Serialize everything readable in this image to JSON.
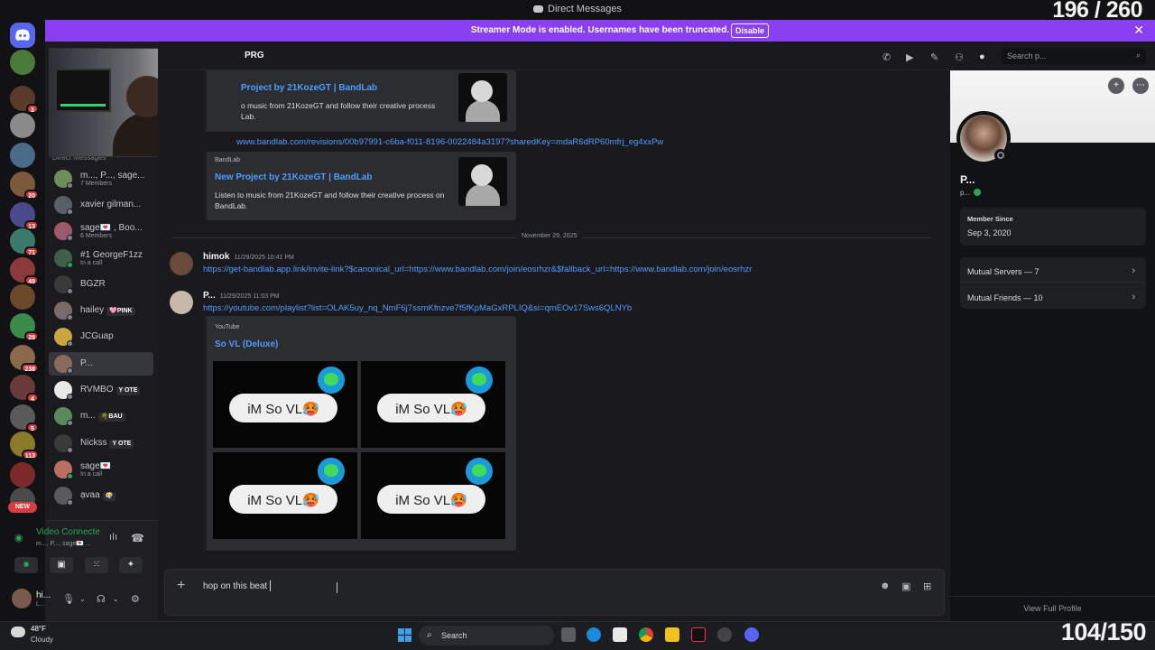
{
  "window": {
    "title": "Direct Messages",
    "overlay_counter_top": "196 / 260",
    "overlay_counter_bottom": "104/150"
  },
  "banner": {
    "message": "Streamer Mode is enabled. Usernames have been truncated.",
    "disable_label": "Disable"
  },
  "servers": [
    {
      "badge": ""
    },
    {
      "badge": "3"
    },
    {
      "badge": ""
    },
    {
      "badge": ""
    },
    {
      "badge": "20"
    },
    {
      "badge": "13"
    },
    {
      "badge": "71"
    },
    {
      "badge": "49"
    },
    {
      "badge": ""
    },
    {
      "badge": "28"
    },
    {
      "badge": "238"
    },
    {
      "badge": "4"
    },
    {
      "badge": "5"
    },
    {
      "badge": "113"
    },
    {
      "badge": ""
    },
    {
      "badge": ""
    }
  ],
  "servers_new_label": "NEW",
  "dm_section_label": "Direct Messages",
  "dms": [
    {
      "name": "m..., P..., sage...",
      "sub": "7 Members",
      "tag": "",
      "color": "#6b8e5a"
    },
    {
      "name": "xavier gilman...",
      "sub": "",
      "tag": "",
      "color": "#5a5f66"
    },
    {
      "name": "sage💌 , Boo...",
      "sub": "6 Members",
      "tag": "",
      "color": "#9a5a6a"
    },
    {
      "name": "#1 GeorgeF1zz",
      "sub": "In a call",
      "tag": "",
      "color": "#3e5f4a"
    },
    {
      "name": "BGZR",
      "sub": "",
      "tag": "",
      "color": "#3a3a3a"
    },
    {
      "name": "hailey",
      "sub": "",
      "tag": "🩷PINK",
      "color": "#7a6a6a"
    },
    {
      "name": "JCGuap",
      "sub": "",
      "tag": "",
      "color": "#c9a640"
    },
    {
      "name": "P...",
      "sub": "",
      "tag": "",
      "color": "#8a6a5a"
    },
    {
      "name": "RVMBO",
      "sub": "",
      "tag": "Y OTE",
      "color": "#e8e8e8"
    },
    {
      "name": "m...",
      "sub": "",
      "tag": "🌴BAU",
      "color": "#5a8a5a"
    },
    {
      "name": "Nickss",
      "sub": "",
      "tag": "Y OTE",
      "color": "#3a3a3a"
    },
    {
      "name": "sage💌",
      "sub": "In a call",
      "tag": "",
      "color": "#b87060"
    },
    {
      "name": "ạvaa",
      "sub": "",
      "tag": "😶‍🌫️",
      "color": "#5a5a5a"
    }
  ],
  "voice": {
    "title": "Video Connecte",
    "sub": "m..., P..., sage💌 ..."
  },
  "user": {
    "name": "hi...",
    "sub": "L..."
  },
  "chat_header": {
    "name": "PRG",
    "search_placeholder": "Search p..."
  },
  "messages": {
    "embed1": {
      "title": "Project by 21KozeGT | BandLab",
      "desc": "o music from 21KozeGT and follow their creative process\nLab."
    },
    "link1": "www.bandlab.com/revisions/00b97991-c6ba-f011-8196-0022484a3197?sharedKey=mdaR6dRP60mfrj_eg4xxPw",
    "embed2": {
      "provider": "BandLab",
      "title": "New Project by 21KozeGT | BandLab",
      "desc": "Listen to music from 21KozeGT and follow their creative process on BandLab."
    },
    "date_divider": "November 29, 2025",
    "msg1": {
      "author": "himok",
      "time": "11/29/2025 10:41 PM",
      "link": "https://get-bandlab.app.link/invite-link?$canonical_url=https://www.bandlab.com/join/eosrhzr&$fallback_url=https://www.bandlab.com/join/eosrhzr"
    },
    "msg2": {
      "author": "P...",
      "time": "11/29/2025 11:03 PM",
      "link": "https://youtube.com/playlist?list=OLAK5uy_nq_NmF6j7ssmKfnzve7f5fKpMaGxRPLIQ&si=qmEOv17Sws6QLNYb"
    },
    "embed3": {
      "provider": "YouTube",
      "title": "So VL (Deluxe)",
      "tile_text": "iM So VL🥵"
    }
  },
  "composer": {
    "value": "hop on this beat"
  },
  "profile": {
    "name": "P...",
    "sub": "p...",
    "member_since_label": "Member Since",
    "member_since_value": "Sep 3, 2020",
    "mutual_servers": "Mutual Servers — 7",
    "mutual_friends": "Mutual Friends — 10",
    "view_full": "View Full Profile"
  },
  "taskbar": {
    "temp": "48°F",
    "weather": "Cloudy",
    "search": "Search"
  },
  "colors": {
    "accent": "#5865f2",
    "banner": "#8a3ff2",
    "link": "#4f9cff",
    "online": "#23a55a"
  }
}
